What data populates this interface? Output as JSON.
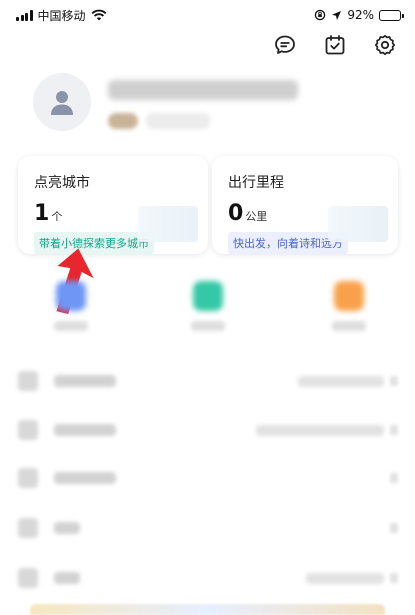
{
  "status_bar": {
    "carrier": "中国移动",
    "battery": "92%",
    "battery_level": 0.92
  },
  "top_icons": [
    "message-icon",
    "checkin-calendar-icon",
    "settings-gear-icon"
  ],
  "profile": {
    "avatar_icon": "default-avatar-icon"
  },
  "cards": {
    "cities": {
      "title": "点亮城市",
      "value": "1",
      "unit": "个",
      "tip": "带着小德探索更多城市"
    },
    "mileage": {
      "title": "出行里程",
      "value": "0",
      "unit": "公里",
      "tip": "快出发，向着诗和远方"
    }
  },
  "colors": {
    "annotation_arrow": "#e8262d",
    "cities_tip": "#14a58a",
    "mileage_tip": "#4a63d6",
    "quick_blue": "#6f96f5",
    "quick_teal": "#33c8a6",
    "quick_orange": "#f8a14a"
  }
}
